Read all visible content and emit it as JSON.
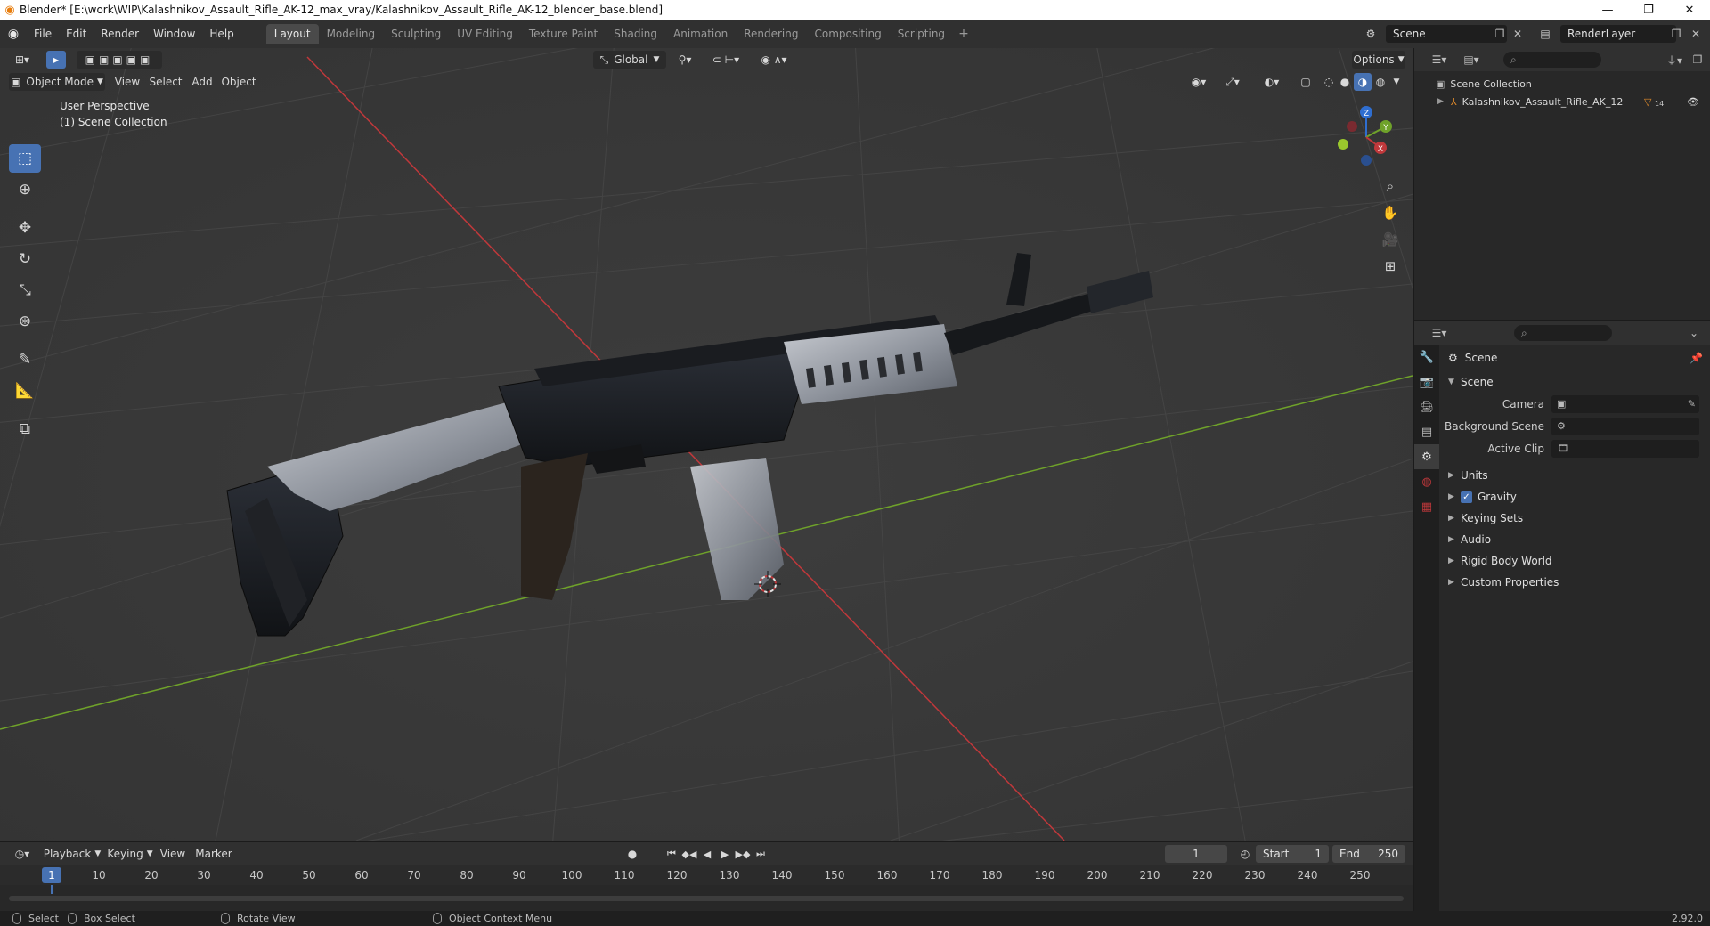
{
  "titlebar": {
    "title": "Blender* [E:\\work\\WIP\\Kalashnikov_Assault_Rifle_AK-12_max_vray/Kalashnikov_Assault_Rifle_AK-12_blender_base.blend]",
    "minimize": "—",
    "maximize": "❐",
    "close": "✕"
  },
  "menu": [
    "File",
    "Edit",
    "Render",
    "Window",
    "Help"
  ],
  "workspaces": {
    "active": "Layout",
    "tabs": [
      "Layout",
      "Modeling",
      "Sculpting",
      "UV Editing",
      "Texture Paint",
      "Shading",
      "Animation",
      "Rendering",
      "Compositing",
      "Scripting"
    ],
    "add": "+"
  },
  "scene_selector": {
    "value": "Scene"
  },
  "view_layer": {
    "value": "RenderLayer"
  },
  "viewport": {
    "transform_orientation": "Global",
    "options_label": "Options",
    "mode": "Object Mode",
    "menus": [
      "View",
      "Select",
      "Add",
      "Object"
    ],
    "overlay_line1": "User Perspective",
    "overlay_line2": "(1) Scene Collection",
    "gizmo": {
      "x": "X",
      "y": "Y",
      "z": "Z"
    }
  },
  "outliner": {
    "root": "Scene Collection",
    "items": [
      {
        "name": "Kalashnikov_Assault_Rifle_AK_12",
        "badge": "14"
      }
    ]
  },
  "properties": {
    "breadcrumb": "Scene",
    "panel_title": "Scene",
    "fields": [
      {
        "label": "Camera",
        "value": ""
      },
      {
        "label": "Background Scene",
        "value": ""
      },
      {
        "label": "Active Clip",
        "value": ""
      }
    ],
    "subpanels": [
      "Units",
      "Gravity",
      "Keying Sets",
      "Audio",
      "Rigid Body World",
      "Custom Properties"
    ],
    "gravity_checked": true
  },
  "timeline": {
    "menus": [
      "Playback",
      "Keying",
      "View",
      "Marker"
    ],
    "current_frame": "1",
    "start_label": "Start",
    "start": "1",
    "end_label": "End",
    "end": "250",
    "ruler": [
      "1",
      "10",
      "20",
      "30",
      "40",
      "50",
      "60",
      "70",
      "80",
      "90",
      "100",
      "110",
      "120",
      "130",
      "140",
      "150",
      "160",
      "170",
      "180",
      "190",
      "200",
      "210",
      "220",
      "230",
      "240",
      "250"
    ]
  },
  "statusbar": {
    "select": "Select",
    "box_select": "Box Select",
    "rotate_view": "Rotate View",
    "context_menu": "Object Context Menu",
    "version": "2.92.0"
  },
  "colors": {
    "accent": "#4772b3",
    "viewport_bg": "#3b3b3b",
    "x_axis": "#c0383b",
    "y_axis": "#6fa22a",
    "panel": "#282828",
    "header": "#303030"
  }
}
